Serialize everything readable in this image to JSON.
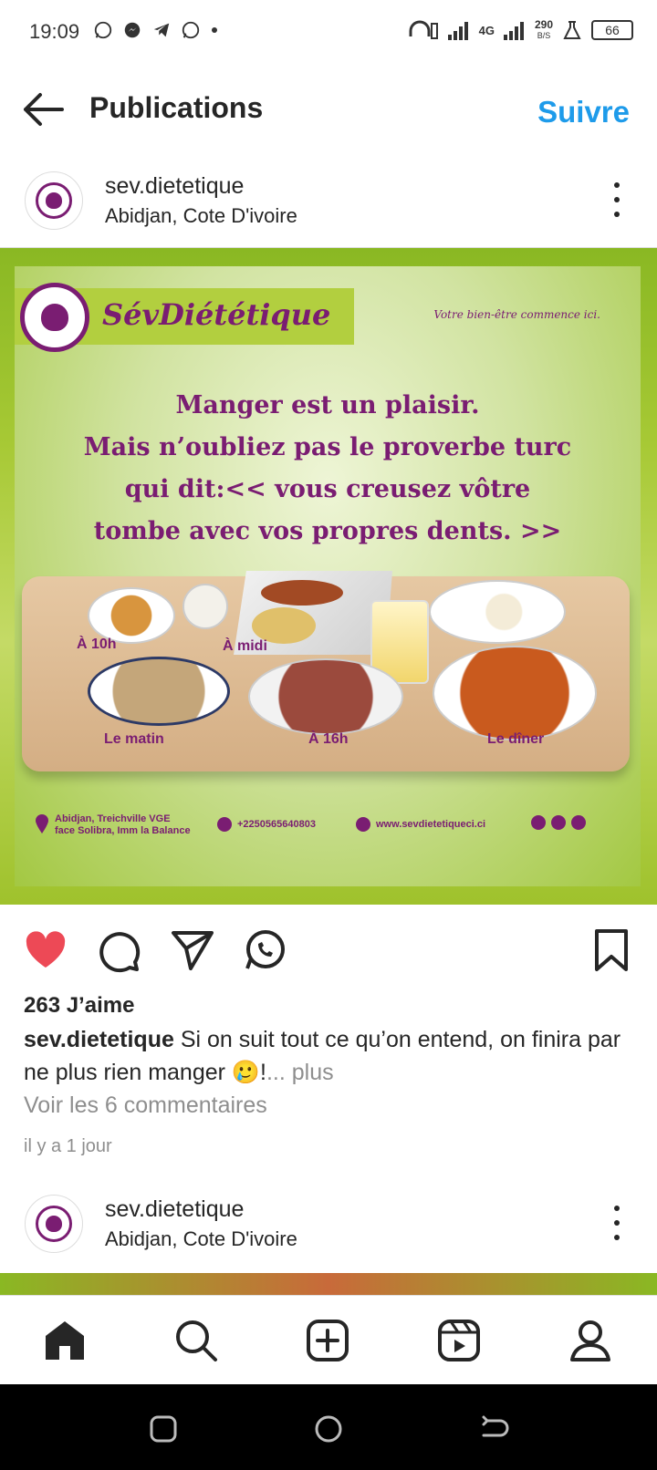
{
  "status": {
    "time": "19:09",
    "network": "4G",
    "speed_value": "290",
    "speed_unit": "B/S",
    "battery": "66"
  },
  "header": {
    "title": "Publications",
    "follow_label": "Suivre"
  },
  "post": {
    "username": "sev.dietetique",
    "location": "Abidjan, Cote D'ivoire",
    "image": {
      "brand": "SévDiététique",
      "tagline": "Votre bien-être commence ici.",
      "quote_lines": [
        "Manger est un plaisir.",
        "Mais n’oubliez pas le proverbe turc",
        "qui dit:<< vous creusez vôtre",
        "tombe avec vos propres dents. >>"
      ],
      "meal_labels": {
        "ten": "À 10h",
        "noon": "À midi",
        "morning": "Le matin",
        "four": "À 16h",
        "dinner": "Le dîner"
      },
      "address_line1": "Abidjan, Treichville VGE",
      "address_line2": "face Solibra, Imm la Balance",
      "phone": "+2250565640803",
      "website": "www.sevdietetiqueci.ci"
    },
    "likes": "263 J’aime",
    "caption_user": "sev.dietetique",
    "caption_text": " Si on suit tout ce qu’on entend, on finira par ne plus rien manger 🥲!",
    "caption_more": "... plus",
    "view_comments": "Voir les 6 commentaires",
    "time_ago": "il y a 1 jour"
  },
  "next_post": {
    "username": "sev.dietetique",
    "location": "Abidjan, Cote D'ivoire"
  },
  "colors": {
    "accent": "#1e9bea",
    "brand_purple": "#7a1d72",
    "like_red": "#ed4956"
  }
}
